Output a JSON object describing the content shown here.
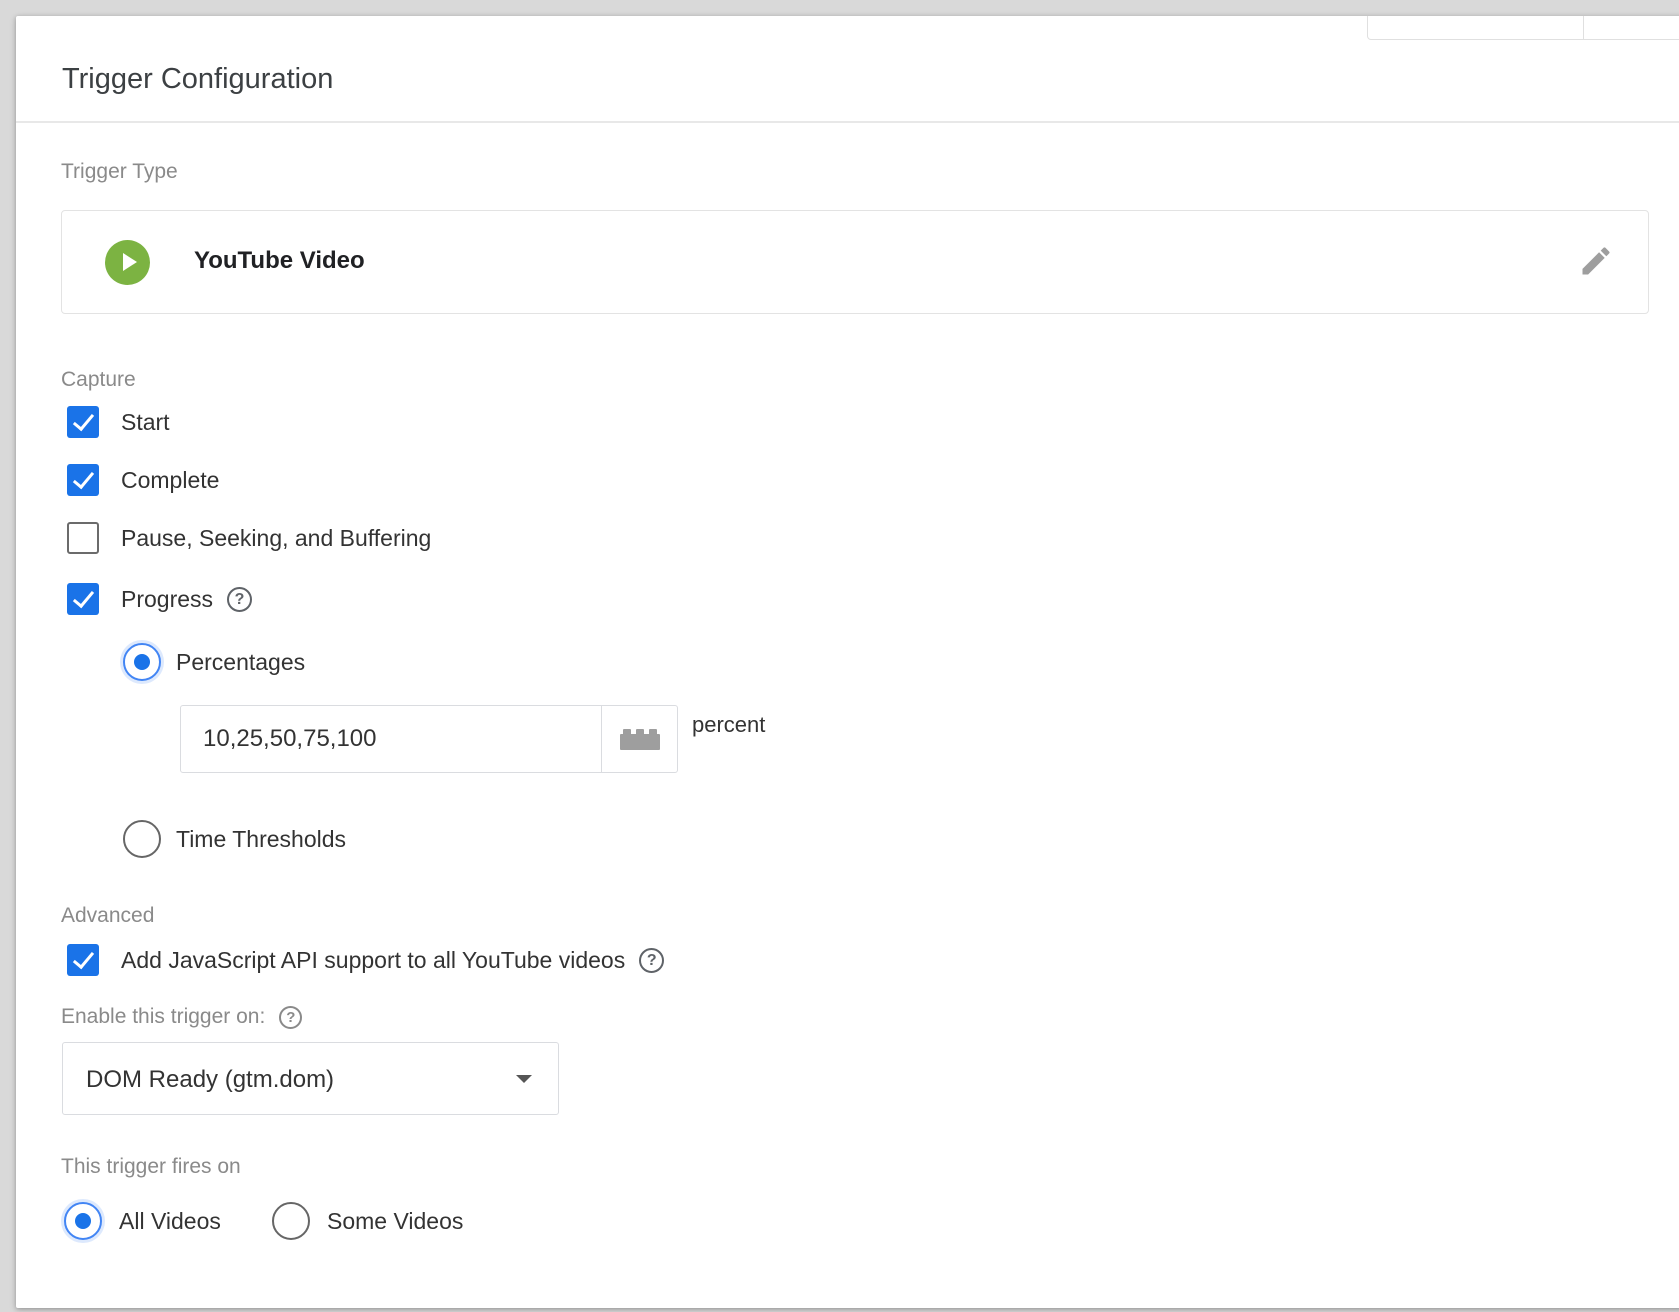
{
  "header": {
    "title": "Trigger Configuration"
  },
  "trigger_type": {
    "section_label": "Trigger Type",
    "name": "YouTube Video",
    "icon": "play-circle-icon",
    "icon_color": "#7cb342"
  },
  "capture": {
    "section_label": "Capture",
    "start": {
      "label": "Start",
      "checked": true
    },
    "complete": {
      "label": "Complete",
      "checked": true
    },
    "pause": {
      "label": "Pause, Seeking, and Buffering",
      "checked": false
    },
    "progress": {
      "label": "Progress",
      "checked": true,
      "percentages": {
        "label": "Percentages",
        "selected": true,
        "value": "10,25,50,75,100",
        "unit": "percent"
      },
      "time_thresholds": {
        "label": "Time Thresholds",
        "selected": false
      }
    }
  },
  "advanced": {
    "section_label": "Advanced",
    "js_api": {
      "label": "Add JavaScript API support to all YouTube videos",
      "checked": true
    },
    "enable_label": "Enable this trigger on:",
    "enable_value": "DOM Ready (gtm.dom)"
  },
  "fires_on": {
    "section_label": "This trigger fires on",
    "all": {
      "label": "All Videos",
      "selected": true
    },
    "some": {
      "label": "Some Videos",
      "selected": false
    }
  },
  "colors": {
    "accent": "#1a73e8",
    "border": "#dadce0"
  }
}
